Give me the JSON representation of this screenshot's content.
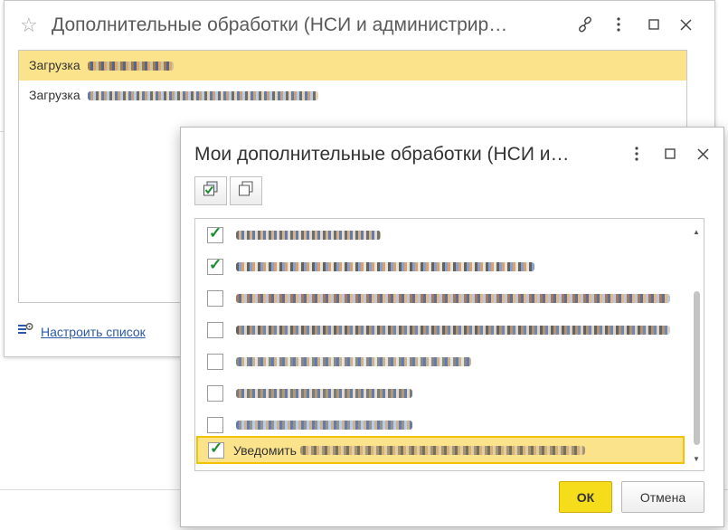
{
  "background_window": {
    "title": "Дополнительные обработки (НСИ и администрир…",
    "items": [
      {
        "label": "Загрузка",
        "selected": true
      },
      {
        "label": "Загрузка",
        "selected": false
      }
    ],
    "setup_link": "Настроить список"
  },
  "dialog": {
    "title": "Мои дополнительные обработки (НСИ и…",
    "items": [
      {
        "label": "",
        "checked": true
      },
      {
        "label": "",
        "checked": true
      },
      {
        "label": "",
        "checked": false
      },
      {
        "label": "",
        "checked": false
      },
      {
        "label": "",
        "checked": false
      },
      {
        "label": "",
        "checked": false
      },
      {
        "label": "",
        "checked": false
      },
      {
        "label": "Уведомить",
        "checked": true,
        "selected": true
      }
    ],
    "ok_label": "ОК",
    "cancel_label": "Отмена"
  },
  "colors": {
    "selection": "#fbe38c",
    "ok_button": "#f5dd1b",
    "link": "#2b5aa7",
    "checkmark": "#1b8e2f"
  },
  "icons": [
    "star-icon",
    "link-icon",
    "more-icon",
    "maximize-icon",
    "close-icon",
    "check-all-icon",
    "uncheck-all-icon",
    "settings-list-icon"
  ]
}
